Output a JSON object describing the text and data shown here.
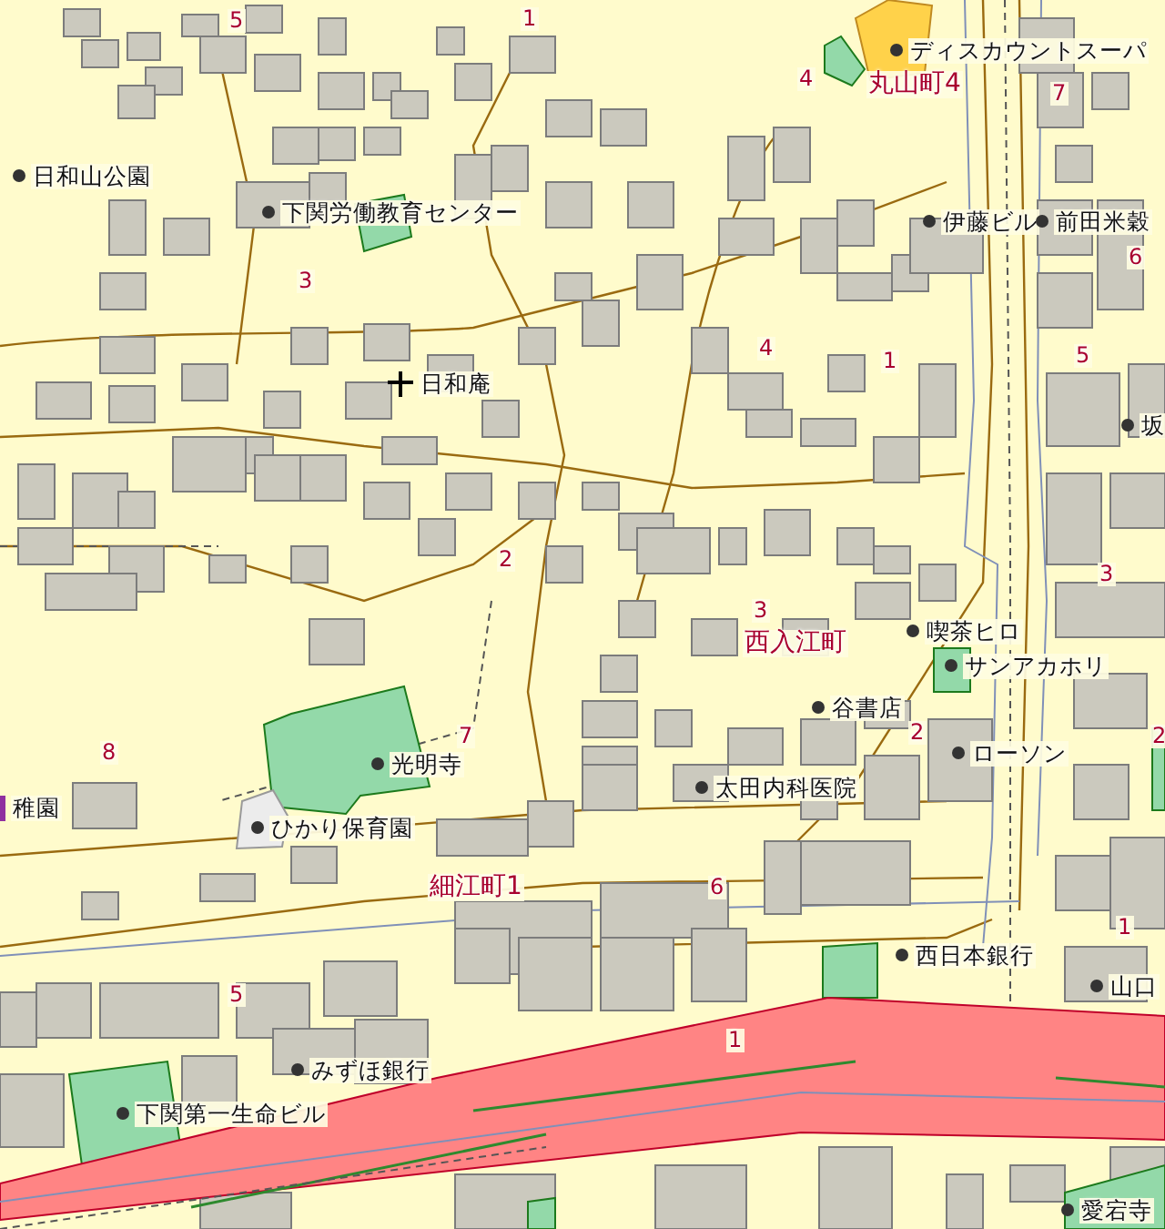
{
  "map": {
    "labels": [
      {
        "kind": "block",
        "text": "5"
      },
      {
        "kind": "block",
        "text": "1"
      },
      {
        "kind": "poi",
        "text": "ディスカウントスーパ"
      },
      {
        "kind": "block",
        "text": "4"
      },
      {
        "kind": "district",
        "text": "丸山町4"
      },
      {
        "kind": "block",
        "text": "7"
      },
      {
        "kind": "poi",
        "text": "日和山公園"
      },
      {
        "kind": "poi",
        "text": "下関労働教育センター"
      },
      {
        "kind": "poi",
        "text": "伊藤ビル"
      },
      {
        "kind": "poi",
        "text": "前田米穀"
      },
      {
        "kind": "block",
        "text": "6"
      },
      {
        "kind": "block",
        "text": "3"
      },
      {
        "kind": "block",
        "text": "4"
      },
      {
        "kind": "block",
        "text": "1"
      },
      {
        "kind": "block",
        "text": "5"
      },
      {
        "kind": "temple",
        "text": "日和庵"
      },
      {
        "kind": "poi",
        "text": "坂"
      },
      {
        "kind": "block",
        "text": "2"
      },
      {
        "kind": "block",
        "text": "3"
      },
      {
        "kind": "block",
        "text": "3"
      },
      {
        "kind": "poi",
        "text": "喫茶ヒロ"
      },
      {
        "kind": "district",
        "text": "西入江町"
      },
      {
        "kind": "poi",
        "text": "サンアカホリ"
      },
      {
        "kind": "poi",
        "text": "谷書店"
      },
      {
        "kind": "block",
        "text": "8"
      },
      {
        "kind": "block",
        "text": "7"
      },
      {
        "kind": "block",
        "text": "2"
      },
      {
        "kind": "block",
        "text": "2"
      },
      {
        "kind": "poi",
        "text": "ローソン"
      },
      {
        "kind": "poi",
        "text": "光明寺"
      },
      {
        "kind": "name",
        "text": "稚園"
      },
      {
        "kind": "poi",
        "text": "太田内科医院"
      },
      {
        "kind": "poi",
        "text": "ひかり保育園"
      },
      {
        "kind": "district",
        "text": "細江町1"
      },
      {
        "kind": "block",
        "text": "6"
      },
      {
        "kind": "block",
        "text": "1"
      },
      {
        "kind": "poi",
        "text": "西日本銀行"
      },
      {
        "kind": "poi",
        "text": "山口"
      },
      {
        "kind": "block",
        "text": "5"
      },
      {
        "kind": "block",
        "text": "1"
      },
      {
        "kind": "poi",
        "text": "みずほ銀行"
      },
      {
        "kind": "poi",
        "text": "下関第一生命ビル"
      },
      {
        "kind": "poi",
        "text": "愛宕寺"
      }
    ]
  }
}
